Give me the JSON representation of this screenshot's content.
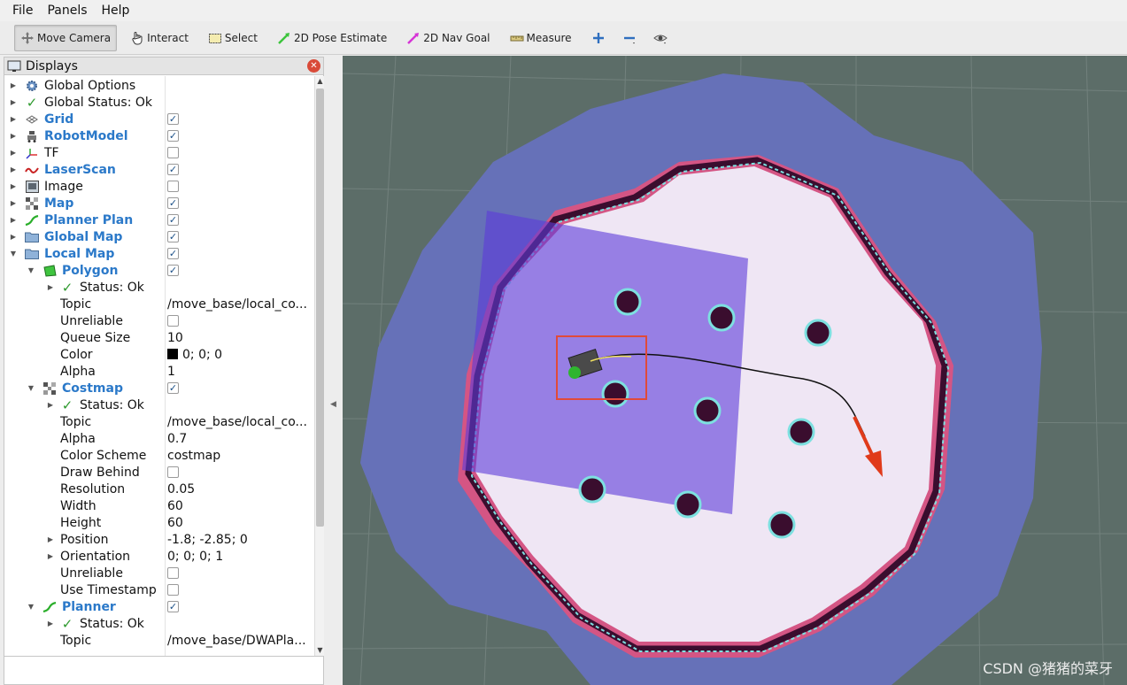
{
  "menu": {
    "file": "File",
    "panels": "Panels",
    "help": "Help"
  },
  "toolbar": {
    "move_camera": "Move Camera",
    "interact": "Interact",
    "select": "Select",
    "pose_estimate": "2D Pose Estimate",
    "nav_goal": "2D Nav Goal",
    "measure": "Measure"
  },
  "displays": {
    "title": "Displays",
    "global_options": "Global Options",
    "global_status": "Global Status: Ok",
    "grid": "Grid",
    "robot_model": "RobotModel",
    "tf": "TF",
    "laser_scan": "LaserScan",
    "image": "Image",
    "map": "Map",
    "planner_plan": "Planner Plan",
    "global_map": "Global Map",
    "local_map": "Local Map",
    "polygon": {
      "name": "Polygon",
      "status": "Status: Ok",
      "topic_label": "Topic",
      "topic_value": "/move_base/local_co...",
      "unreliable_label": "Unreliable",
      "queue_size_label": "Queue Size",
      "queue_size_value": "10",
      "color_label": "Color",
      "color_value": "0; 0; 0",
      "alpha_label": "Alpha",
      "alpha_value": "1"
    },
    "costmap": {
      "name": "Costmap",
      "status": "Status: Ok",
      "topic_label": "Topic",
      "topic_value": "/move_base/local_co...",
      "alpha_label": "Alpha",
      "alpha_value": "0.7",
      "color_scheme_label": "Color Scheme",
      "color_scheme_value": "costmap",
      "draw_behind_label": "Draw Behind",
      "resolution_label": "Resolution",
      "resolution_value": "0.05",
      "width_label": "Width",
      "width_value": "60",
      "height_label": "Height",
      "height_value": "60",
      "position_label": "Position",
      "position_value": "-1.8; -2.85; 0",
      "orientation_label": "Orientation",
      "orientation_value": "0; 0; 0; 1",
      "unreliable_label": "Unreliable",
      "use_timestamp_label": "Use Timestamp"
    },
    "planner": {
      "name": "Planner",
      "status": "Status: Ok",
      "topic_label": "Topic",
      "topic_value": "/move_base/DWAPla..."
    }
  },
  "checkboxes": {
    "grid": true,
    "robot_model": true,
    "tf": false,
    "laser_scan": true,
    "image": false,
    "map": true,
    "planner_plan": true,
    "global_map": true,
    "local_map": true,
    "polygon": true,
    "polygon_unreliable": false,
    "costmap": true,
    "draw_behind": false,
    "costmap_unreliable": false,
    "use_timestamp": false,
    "planner": true
  },
  "watermark": "CSDN @猪猪的菜牙",
  "colors": {
    "background": "#5c6d68",
    "costmap_outer": "#6671b8",
    "costmap_free": "#efe6f4",
    "inflation": "#e8507a",
    "obstacle": "#3a0d2e",
    "local_costmap": "#5b3ad8",
    "path": "#111111",
    "goal_arrow": "#e03a1a",
    "selection_box": "#e04a3a"
  }
}
